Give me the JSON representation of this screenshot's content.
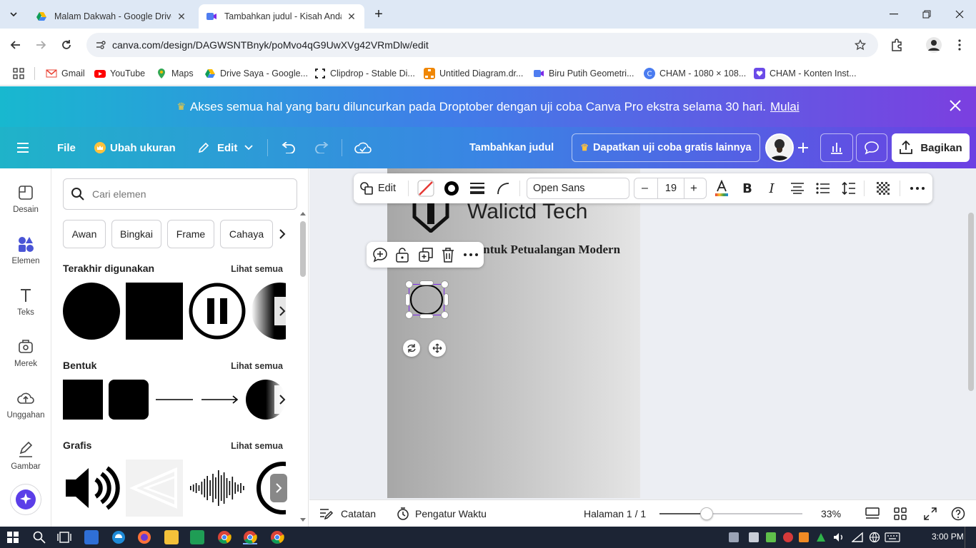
{
  "browser": {
    "tabs": [
      {
        "title": "Malam Dakwah - Google Drive"
      },
      {
        "title": "Tambahkan judul - Kisah Anda"
      }
    ],
    "url": "canva.com/design/DAGWSNTBnyk/poMvo4qG9UwXVg42VRmDlw/edit",
    "bookmarks": [
      {
        "label": "Gmail"
      },
      {
        "label": "YouTube"
      },
      {
        "label": "Maps"
      },
      {
        "label": "Drive Saya - Google..."
      },
      {
        "label": "Clipdrop - Stable Di..."
      },
      {
        "label": "Untitled Diagram.dr..."
      },
      {
        "label": "Biru Putih Geometri..."
      },
      {
        "label": "CHAM - 1080 × 108..."
      },
      {
        "label": "CHAM - Konten Inst..."
      }
    ]
  },
  "promo": {
    "text": "Akses semua hal yang baru diluncurkan pada Droptober dengan uji coba Canva Pro ekstra selama 30 hari.",
    "link": "Mulai"
  },
  "header": {
    "file": "File",
    "resize": "Ubah ukuran",
    "edit": "Edit",
    "title": "Tambahkan judul",
    "trial": "Dapatkan uji coba gratis lainnya",
    "share": "Bagikan"
  },
  "rail": {
    "items": [
      {
        "label": "Desain"
      },
      {
        "label": "Elemen"
      },
      {
        "label": "Teks"
      },
      {
        "label": "Merek"
      },
      {
        "label": "Unggahan"
      },
      {
        "label": "Gambar"
      }
    ]
  },
  "panel": {
    "search_placeholder": "Cari elemen",
    "chips": [
      "Awan",
      "Bingkai",
      "Frame",
      "Cahaya"
    ],
    "see_all": "Lihat semua",
    "sections": {
      "recent": "Terakhir digunakan",
      "shapes": "Bentuk",
      "graphics": "Grafis"
    }
  },
  "toolbar": {
    "edit": "Edit",
    "font": "Open Sans",
    "font_size": "19"
  },
  "canvas": {
    "heading": "Walictd Tech",
    "subheading": "Untuk Petualangan Modern"
  },
  "bottom": {
    "notes": "Catatan",
    "timer": "Pengatur Waktu",
    "page": "Halaman 1 / 1",
    "zoom": "33%",
    "zoom_fraction": 0.33
  },
  "taskbar": {
    "time": "3:00 PM"
  },
  "colors": {
    "accent": "#7d2ae8",
    "teal": "#1fb3c9"
  }
}
